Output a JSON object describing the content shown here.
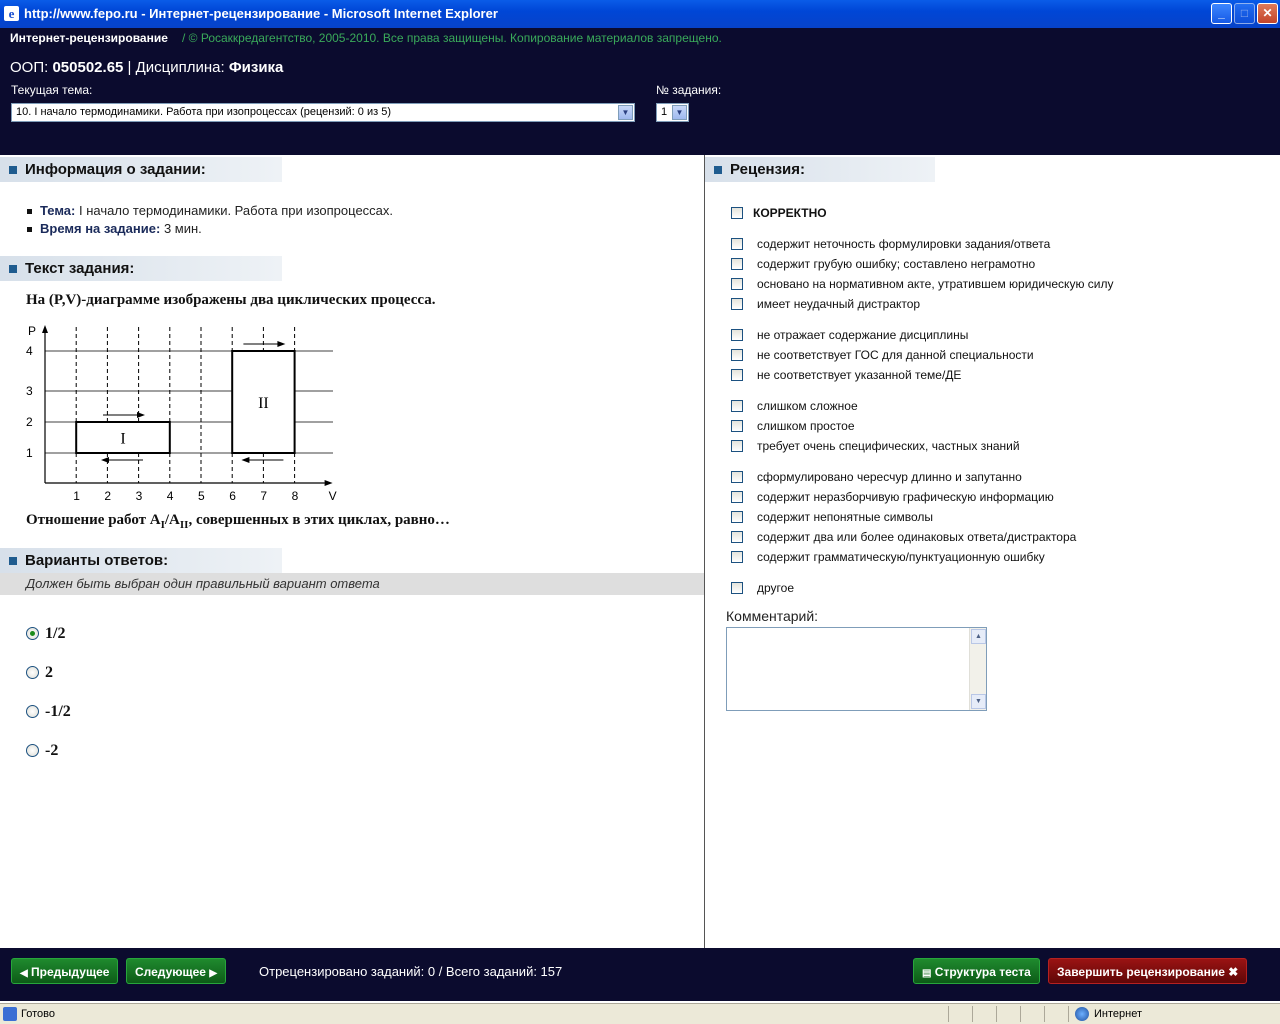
{
  "window": {
    "title": "http://www.fepo.ru - Интернет-рецензирование - Microsoft Internet Explorer"
  },
  "header": {
    "brand": "Интернет-рецензирование",
    "copyright": "/  © Росаккредагентство, 2005-2010. Все права защищены. Копирование материалов запрещено.",
    "oop_label": "ООП:",
    "oop_value": "050502.65",
    "discipline_label": "| Дисциплина:",
    "discipline_value": "Физика",
    "topic_label": "Текущая тема:",
    "topic_value": "10. I начало термодинамики. Работа при изопроцессах  (рецензий: 0 из 5)",
    "task_num_label": "№ задания:",
    "task_num_value": "1"
  },
  "task_info": {
    "heading": "Информация о задании:",
    "topic_label": "Тема:",
    "topic_value": "I начало термодинамики. Работа при изопроцессах.",
    "time_label": "Время на задание:",
    "time_value": "3 мин."
  },
  "task_text": {
    "heading": "Текст задания:",
    "line1": "На (P,V)-диаграмме изображены два циклических процесса.",
    "line2_pre": "Отношение работ A",
    "sub1": "I",
    "slash": "/A",
    "sub2": "II",
    "line2_post": ", совершенных в этих циклах, равно…"
  },
  "diagram": {
    "y_axis_label": "P",
    "x_axis_label": "V",
    "y_ticks": [
      "1",
      "2",
      "3",
      "4"
    ],
    "x_ticks": [
      "1",
      "2",
      "3",
      "4",
      "5",
      "6",
      "7",
      "8"
    ],
    "cycles": [
      {
        "label": "I",
        "v_min": 1,
        "v_max": 4,
        "p_min": 1,
        "p_max": 2
      },
      {
        "label": "II",
        "v_min": 6,
        "v_max": 8,
        "p_min": 1,
        "p_max": 4
      }
    ]
  },
  "answers": {
    "heading": "Варианты ответов:",
    "hint": "Должен быть выбран один правильный вариант ответа",
    "options": [
      {
        "text": "1/2",
        "selected": true
      },
      {
        "text": "2",
        "selected": false
      },
      {
        "text": "-1/2",
        "selected": false
      },
      {
        "text": "-2",
        "selected": false
      }
    ]
  },
  "review": {
    "heading": "Рецензия:",
    "correct_label": "КОРРЕКТНО",
    "items": [
      "содержит неточность формулировки задания/ответа",
      "содержит грубую ошибку; составлено неграмотно",
      "основано на нормативном акте, утратившем юридическую силу",
      "имеет неудачный дистрактор",
      "не отражает содержание дисциплины",
      "не соответствует ГОС для данной специальности",
      "не соответствует указанной теме/ДЕ",
      "слишком сложное",
      "слишком простое",
      "требует очень специфических, частных знаний",
      "сформулировано чересчур длинно и запутанно",
      "содержит неразборчивую графическую информацию",
      "содержит непонятные символы",
      "содержит два или более одинаковых ответа/дистрактора",
      "содержит грамматическую/пунктуационную ошибку",
      "другое"
    ],
    "comment_label": "Комментарий:",
    "comment_value": ""
  },
  "footer": {
    "prev_label": "Предыдущее",
    "next_label": "Следующее",
    "stats": "Отрецензировано заданий: 0 / Всего заданий:  157",
    "structure_label": "Структура теста",
    "finish_label": "Завершить рецензирование"
  },
  "statusbar": {
    "status": "Готово",
    "zone": "Интернет"
  }
}
